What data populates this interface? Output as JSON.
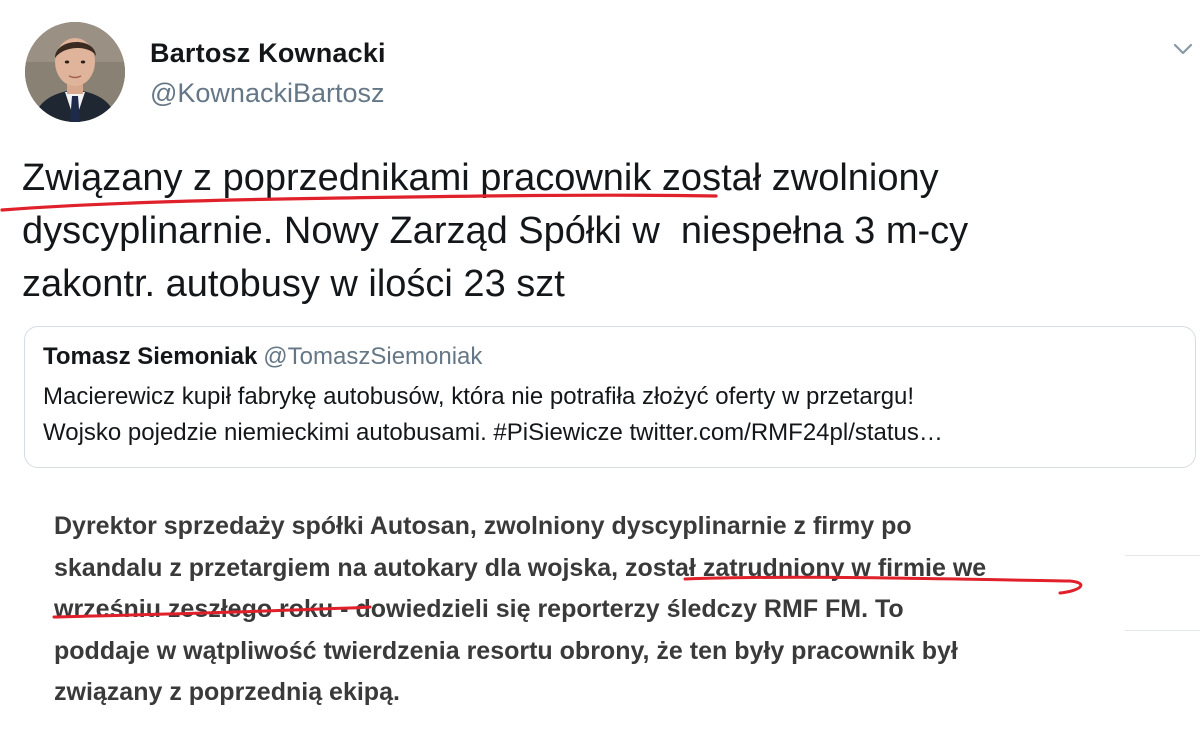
{
  "tweet": {
    "author_name": "Bartosz Kownacki",
    "author_handle": "@KownackiBartosz",
    "text_lines": [
      "Związany z poprzednikami pracownik został zwolniony",
      "dyscyplinarnie. Nowy Zarząd Spółki w  niespełna 3 m-cy",
      "zakontr. autobusy w ilości 23 szt"
    ],
    "menu_icon": "chevron-down-icon",
    "accent_color": "#e0202a"
  },
  "quote": {
    "author_name": "Tomasz Siemoniak",
    "author_handle": "@TomaszSiemoniak",
    "text_lines": [
      "Macierewicz kupił fabrykę autobusów, która nie potrafiła złożyć oferty w przetargu!",
      "Wojsko pojedzie niemieckimi autobusami. #PiSiewicze twitter.com/RMF24pl/status…"
    ]
  },
  "article": {
    "text_lines": [
      "Dyrektor sprzedaży spółki Autosan, zwolniony dyscyplinarnie z firmy po",
      "skandalu z przetargiem na autokary dla wojska, został zatrudniony w firmie we",
      "wrześniu zeszłego roku - dowiedzieli się reporterzy śledczy RMF FM. To",
      "poddaje w wątpliwość twierdzenia resortu obrony, że ten były pracownik był",
      "związany z poprzednią ekipą."
    ]
  }
}
